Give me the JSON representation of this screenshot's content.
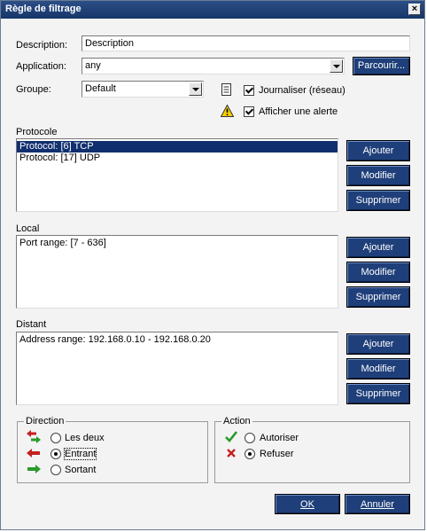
{
  "window": {
    "title": "Règle de filtrage",
    "close_label": "×"
  },
  "fields": {
    "description_label": "Description:",
    "description_value": "Description",
    "application_label": "Application:",
    "application_value": "any",
    "browse_button": "Parcourir...",
    "group_label": "Groupe:",
    "group_value": "Default"
  },
  "options": {
    "log_label": "Journaliser (réseau)",
    "log_checked": true,
    "alert_label": "Afficher une alerte",
    "alert_checked": true
  },
  "protocol": {
    "label": "Protocole",
    "items": [
      {
        "text": "Protocol: [6] TCP",
        "selected": true
      },
      {
        "text": "Protocol: [17] UDP",
        "selected": false
      }
    ]
  },
  "local": {
    "label": "Local",
    "items": [
      {
        "text": "Port range: [7 - 636]"
      }
    ]
  },
  "remote": {
    "label": "Distant",
    "items": [
      {
        "text": "Address range: 192.168.0.10 - 192.168.0.20"
      }
    ]
  },
  "list_buttons": {
    "add": "Ajouter",
    "edit": "Modifier",
    "delete": "Supprimer"
  },
  "direction": {
    "title": "Direction",
    "options": [
      {
        "label": "Les deux",
        "selected": false
      },
      {
        "label": "Entrant",
        "selected": true
      },
      {
        "label": "Sortant",
        "selected": false
      }
    ]
  },
  "action": {
    "title": "Action",
    "options": [
      {
        "label": "Autoriser",
        "selected": false
      },
      {
        "label": "Refuser",
        "selected": true
      }
    ]
  },
  "footer": {
    "ok": "OK",
    "cancel": "Annuler"
  },
  "colors": {
    "button_bg": "#1f3f7a",
    "titlebar": "#16356a",
    "selection": "#102f6e",
    "allow": "#2a9a2a",
    "deny": "#c42020"
  }
}
